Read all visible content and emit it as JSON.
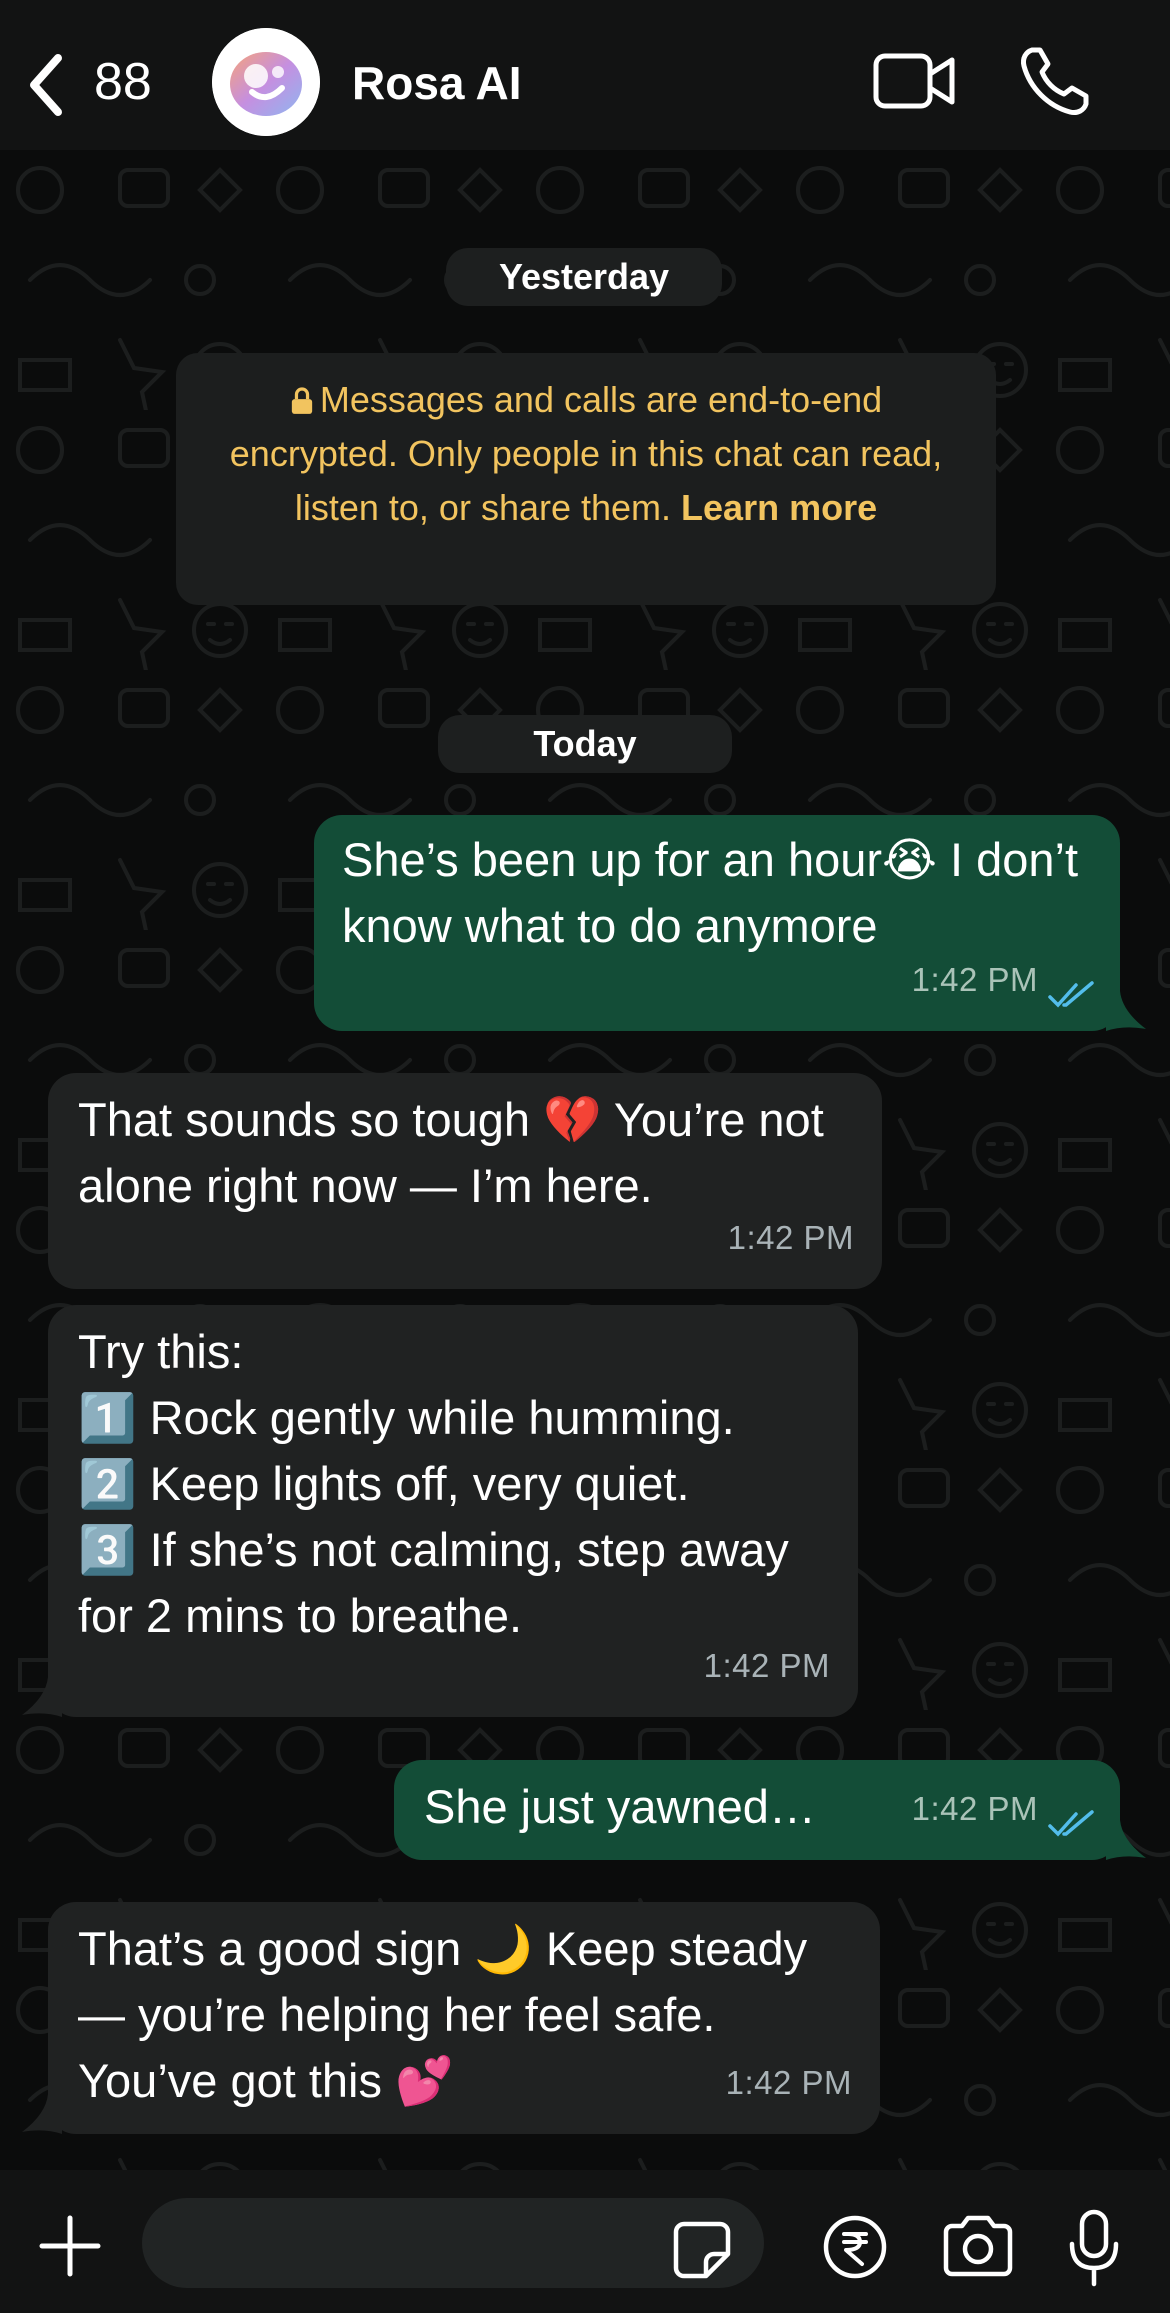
{
  "header": {
    "back_count": "88",
    "contact_name": "Rosa AI"
  },
  "chat": {
    "date_yesterday": "Yesterday",
    "encryption_notice": "Messages and calls are end-to-end encrypted. Only people in this chat can read, listen to, or share them.",
    "encryption_learn_more": "Learn more",
    "date_today": "Today",
    "messages": [
      {
        "direction": "out",
        "text": "She’s been up for an hour😭 I don’t know what to do anymore",
        "time": "1:42 PM",
        "status": "read"
      },
      {
        "direction": "in",
        "text": "That sounds so tough 💔 You’re not alone right now — I’m here.",
        "time": "1:42 PM"
      },
      {
        "direction": "in",
        "text": "Try this:\n1️⃣ Rock gently while humming.\n2️⃣ Keep lights off, very quiet.\n3️⃣ If she’s not calming, step away for 2 mins to breathe.",
        "time": "1:42 PM"
      },
      {
        "direction": "out",
        "text": "She just yawned…",
        "time": "1:42 PM",
        "status": "read"
      },
      {
        "direction": "in",
        "text": "That’s a good sign 🌙 Keep steady — you’re helping her feel safe. You’ve got this 💕",
        "time": "1:42 PM"
      }
    ]
  },
  "composer": {
    "input_value": "",
    "icons": [
      "plus-icon",
      "sticker-icon",
      "rupee-icon",
      "camera-icon",
      "microphone-icon"
    ]
  },
  "colors": {
    "outgoing_bubble": "#134d37",
    "incoming_bubble": "#202222",
    "encryption_text": "#f2c45f",
    "read_ticks": "#53bdeb"
  }
}
